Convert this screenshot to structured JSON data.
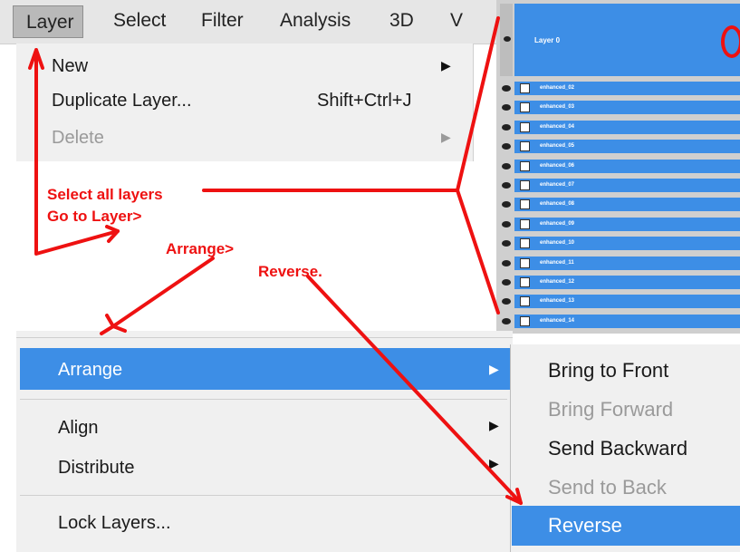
{
  "menubar": {
    "items": [
      "Layer",
      "Select",
      "Filter",
      "Analysis",
      "3D",
      "V"
    ]
  },
  "layer_menu": {
    "new_label": "New",
    "duplicate_label": "Duplicate Layer...",
    "duplicate_shortcut": "Shift+Ctrl+J",
    "delete_label": "Delete"
  },
  "layers_panel": {
    "top_layer": "Layer 0",
    "layers": [
      "enhanced_02",
      "enhanced_03",
      "enhanced_04",
      "enhanced_05",
      "enhanced_06",
      "enhanced_07",
      "enhanced_08",
      "enhanced_09",
      "enhanced_10",
      "enhanced_11",
      "enhanced_12",
      "enhanced_13",
      "enhanced_14"
    ]
  },
  "lower_menu": {
    "arrange_label": "Arrange",
    "align_label": "Align",
    "distribute_label": "Distribute",
    "lock_label": "Lock Layers..."
  },
  "submenu": {
    "bring_to_front": "Bring to Front",
    "bring_forward": "Bring Forward",
    "send_backward": "Send Backward",
    "send_to_back": "Send to Back",
    "reverse": "Reverse"
  },
  "annotations": {
    "line1": "Select all layers",
    "line2": "Go to Layer>",
    "line3": "Arrange>",
    "line4": "Reverse."
  },
  "colors": {
    "highlight": "#3d8ee6",
    "annotation": "#ee1111"
  }
}
